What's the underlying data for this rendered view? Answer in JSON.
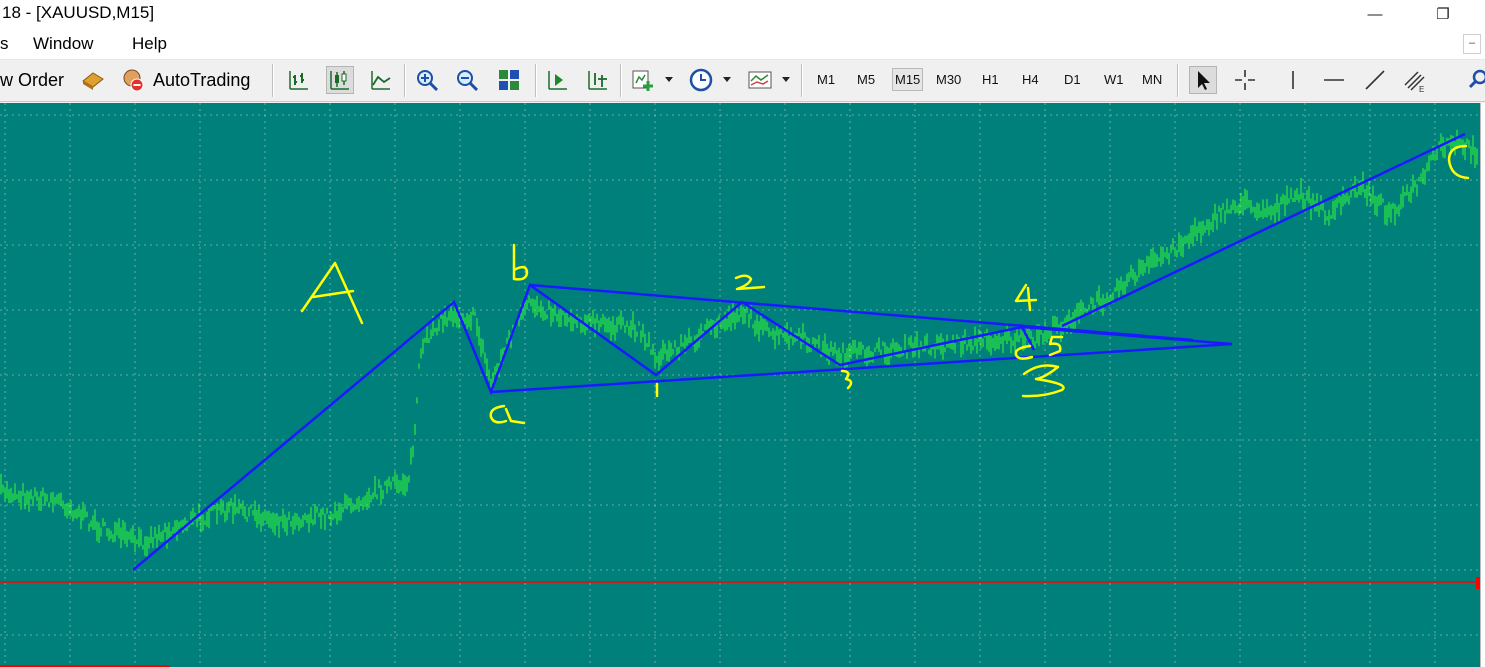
{
  "window": {
    "title": "18 - [XAUUSD,M15]",
    "minimize": "—",
    "restore": "❐"
  },
  "menu": {
    "items": [
      "s",
      "Window",
      "Help"
    ],
    "mdi_minimize": "–"
  },
  "toolbar": {
    "new_order": "w Order",
    "autotrading": "AutoTrading",
    "timeframes": [
      "M1",
      "M5",
      "M15",
      "M30",
      "H1",
      "H4",
      "D1",
      "W1",
      "MN"
    ],
    "active_timeframe": "M15",
    "icons": [
      "bar-chart-icon",
      "candlestick-icon",
      "line-chart-icon",
      "zoom-in-icon",
      "zoom-out-icon",
      "tile-windows-icon",
      "chart-shift-icon",
      "autoscroll-icon",
      "indicators-icon",
      "periods-icon",
      "templates-icon",
      "cursor-icon",
      "crosshair-icon",
      "vertical-line-icon",
      "horizontal-line-icon",
      "trendline-icon",
      "fibonacci-icon",
      "search-icon"
    ]
  },
  "chart": {
    "symbol": "XAUUSD",
    "timeframe": "M15",
    "colors": {
      "background": "#00807a",
      "candles": "#33ff33",
      "grid": "#8fb5b3",
      "annotation_lines": "#1a1aff",
      "handwriting": "#ffff00",
      "price_line": "#ff0000"
    },
    "handwritten_labels": [
      "A",
      "b",
      "a",
      "1",
      "2",
      "3",
      "4",
      "5",
      "c",
      "B",
      "C"
    ]
  }
}
